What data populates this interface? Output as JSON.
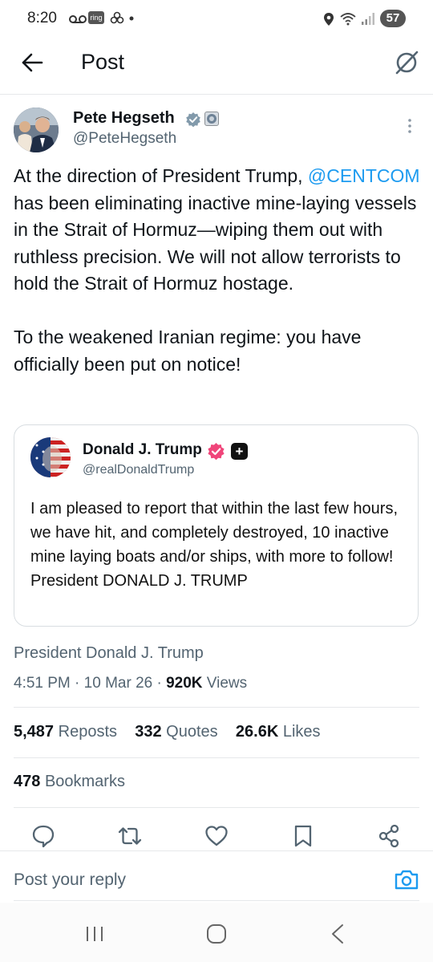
{
  "status_bar": {
    "time": "8:20",
    "ring_label": "ring",
    "battery": "57"
  },
  "header": {
    "title": "Post"
  },
  "post": {
    "author_name": "Pete Hegseth",
    "author_handle": "@PeteHegseth",
    "text_before_mention": "At the direction of President Trump, ",
    "mention": "@CENTCOM",
    "text_after_mention": " has been eliminating inactive mine-laying vessels in the Strait of Hormuz—wiping them out with ruthless precision. We will not allow terrorists to hold the Strait of Hormuz hostage.\n\nTo the weakened Iranian regime: you have officially been put on notice!"
  },
  "quote": {
    "author_name": "Donald J. Trump",
    "author_handle": "@realDonaldTrump",
    "text": "I am pleased to report that within the last few hours, we have hit, and completely destroyed, 10 inactive mine laying boats and/or ships, with more to follow! President DONALD J. TRUMP"
  },
  "meta": {
    "source": "President Donald J. Trump",
    "time": "4:51 PM",
    "date": "10 Mar 26",
    "views_count": "920K",
    "views_label": "Views"
  },
  "stats": {
    "reposts_count": "5,487",
    "reposts_label": "Reposts",
    "quotes_count": "332",
    "quotes_label": "Quotes",
    "likes_count": "26.6K",
    "likes_label": "Likes",
    "bookmarks_count": "478",
    "bookmarks_label": "Bookmarks"
  },
  "reply": {
    "placeholder": "Post your reply"
  },
  "icons": {
    "back": "arrow-left-icon",
    "grok": "grok-icon",
    "more": "more-vertical-icon",
    "reply": "reply-icon",
    "repost": "repost-icon",
    "like": "heart-icon",
    "bookmark": "bookmark-icon",
    "share": "share-icon",
    "camera": "camera-icon"
  },
  "colors": {
    "link": "#1d9bf0",
    "text": "#0f1419",
    "secondary": "#536471",
    "verified_pink": "#f0457a"
  }
}
